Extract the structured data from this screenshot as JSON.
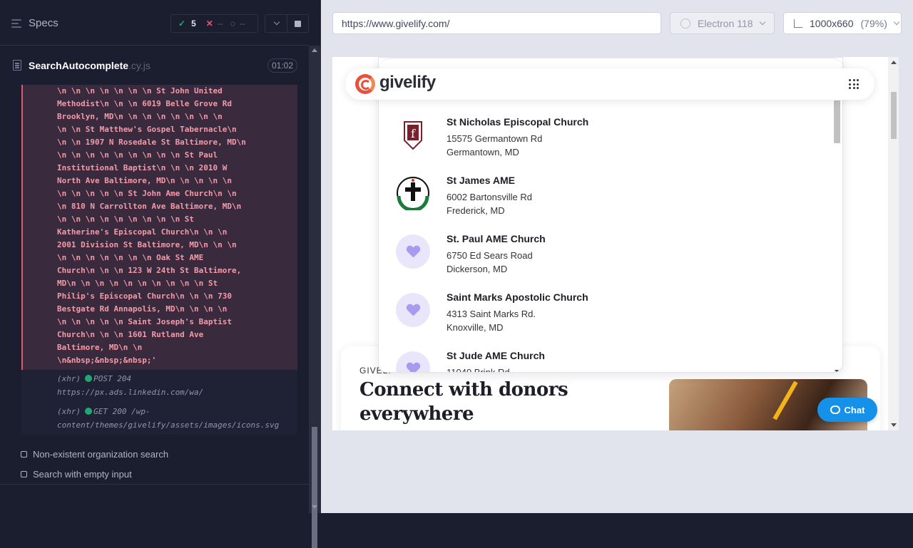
{
  "runner": {
    "specs_label": "Specs",
    "stats": {
      "passed": "5",
      "failed": "--",
      "pending": "--"
    },
    "spec": {
      "name": "SearchAutocomplete",
      "ext": ".cy.js",
      "duration": "01:02"
    },
    "error_text": "\\n \\n \\n \\n \\n \\n \\n St John United\nMethodist\\n \\n \\n 6019 Belle Grove Rd\nBrooklyn, MD\\n \\n \\n \\n \\n \\n \\n \\n\n\\n \\n St Matthew's Gospel Tabernacle\\n\n\\n \\n 1907 N Rosedale St Baltimore, MD\\n\n\\n \\n \\n \\n \\n \\n \\n \\n \\n St Paul\nInstitutional Baptist\\n \\n \\n 2010 W\nNorth Ave Baltimore, MD\\n \\n \\n \\n \\n\n\\n \\n \\n \\n \\n St John Ame Church\\n \\n\n\\n 810 N Carrollton Ave Baltimore, MD\\n\n\\n \\n \\n \\n \\n \\n \\n \\n \\n St\nKatherine's Episcopal Church\\n \\n \\n\n2001 Division St Baltimore, MD\\n \\n \\n\n\\n \\n \\n \\n \\n \\n \\n Oak St AME\nChurch\\n \\n \\n 123 W 24th St Baltimore,\nMD\\n \\n \\n \\n \\n \\n \\n \\n \\n \\n St\nPhilip's Episcopal Church\\n \\n \\n 730\nBestgate Rd Annapolis, MD\\n \\n \\n \\n\n\\n \\n \\n \\n \\n Saint Joseph's Baptist\nChurch\\n \\n \\n 1601 Rutland Ave\nBaltimore, MD\\n \\n\n\\n&nbsp;&nbsp;&nbsp;'",
    "xhr": [
      {
        "tag": "(xhr)",
        "status": "POST 204",
        "url": "https://px.ads.linkedin.com/wa/"
      },
      {
        "tag": "(xhr)",
        "status": "GET 200 /wp-",
        "url": "content/themes/givelify/assets/images/icons.svg"
      }
    ],
    "tests": [
      {
        "label": "Non-existent organization search"
      },
      {
        "label": "Search with empty input"
      }
    ]
  },
  "aut_header": {
    "url": "https://www.givelify.com/",
    "browser": "Electron 118",
    "viewport": "1000x660",
    "zoom": "(79%)"
  },
  "site": {
    "logo_text": "givelify",
    "results": [
      {
        "name": "St Nicholas Episcopal Church",
        "addr1": "15575 Germantown Rd",
        "addr2": "Germantown, MD"
      },
      {
        "name": "St James AME",
        "addr1": "6002 Bartonsville Rd",
        "addr2": "Frederick, MD"
      },
      {
        "name": "St. Paul AME Church",
        "addr1": "6750 Ed Sears Road",
        "addr2": "Dickerson, MD"
      },
      {
        "name": "Saint Marks Apostolic Church",
        "addr1": "4313 Saint Marks Rd.",
        "addr2": "Knoxville, MD"
      },
      {
        "name": "St Jude AME Church",
        "addr1": "11040 Brink Rd",
        "addr2": ""
      }
    ],
    "card": {
      "eyebrow": "GIVELI",
      "title_line1": "Connect with donors",
      "title_line2": "everywhere"
    },
    "chat_label": "Chat"
  }
}
